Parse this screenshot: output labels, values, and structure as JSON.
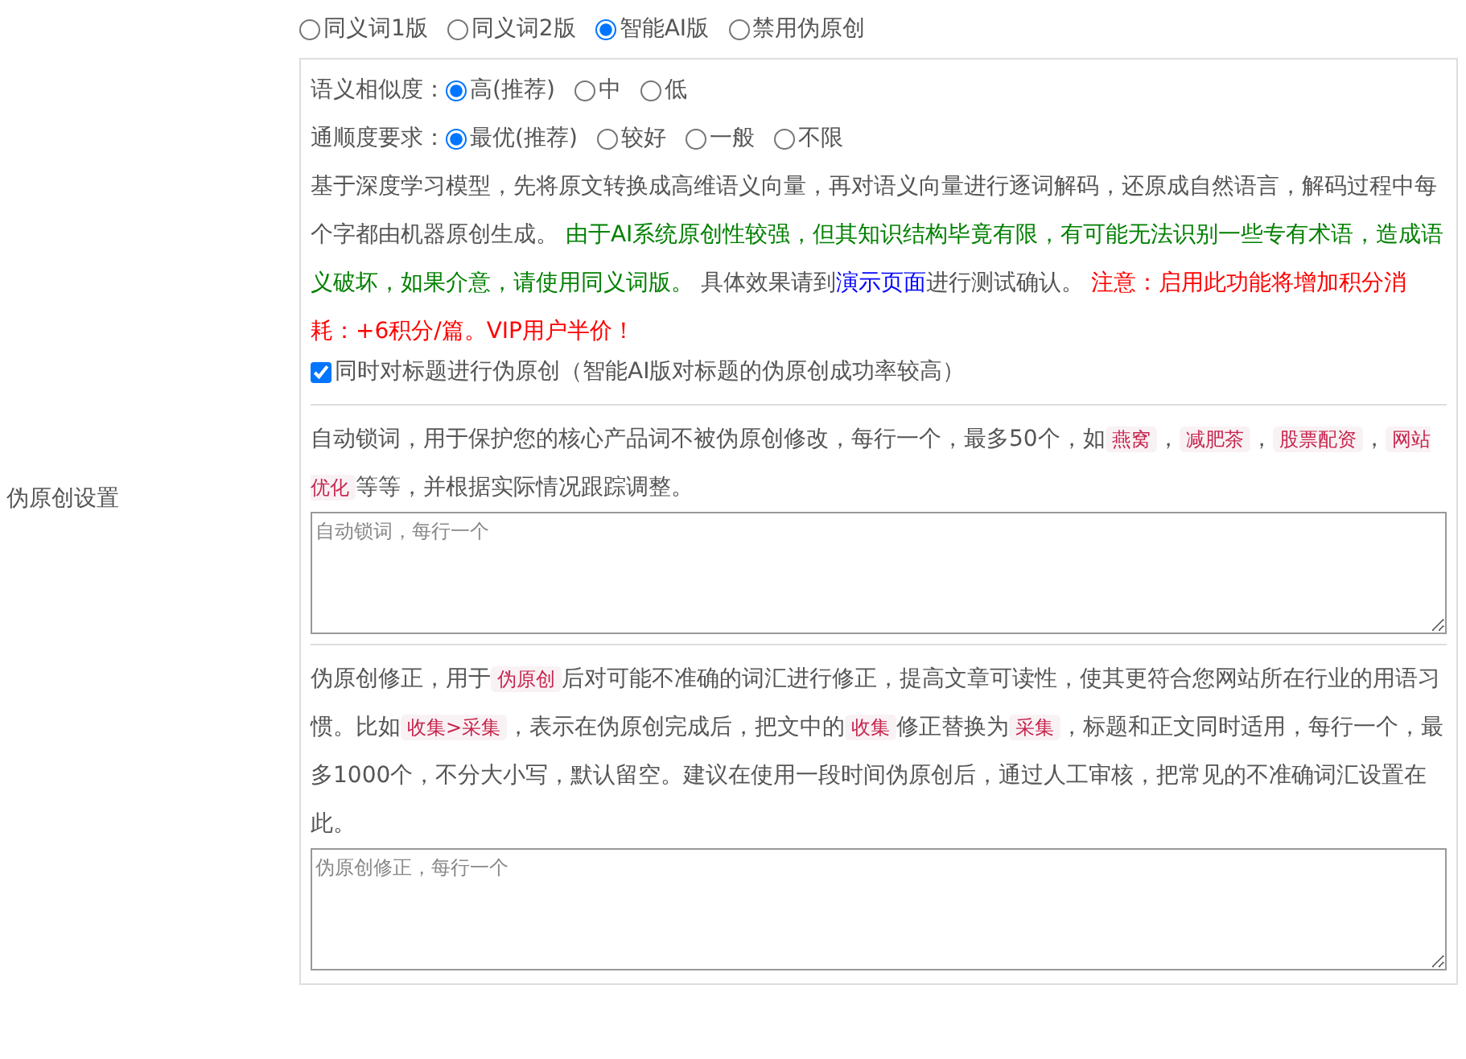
{
  "section_label": "伪原创设置",
  "modes": [
    {
      "label": "同义词1版",
      "selected": false
    },
    {
      "label": "同义词2版",
      "selected": false
    },
    {
      "label": "智能AI版",
      "selected": true
    },
    {
      "label": "禁用伪原创",
      "selected": false
    }
  ],
  "settings": [
    {
      "label": "语义相似度：",
      "options": [
        {
          "label": "高(推荐)",
          "selected": true
        },
        {
          "label": "中",
          "selected": false
        },
        {
          "label": "低",
          "selected": false
        }
      ]
    },
    {
      "label": "通顺度要求：",
      "options": [
        {
          "label": "最优(推荐)",
          "selected": true
        },
        {
          "label": "较好",
          "selected": false
        },
        {
          "label": "一般",
          "selected": false
        },
        {
          "label": "不限",
          "selected": false
        }
      ]
    }
  ],
  "description": [
    {
      "kind": "text",
      "text": "基于深度学习模型，先将原文转换成高维语义向量，再对语义向量进行逐词解码，还原成自然语言，解码过程中每个字都由机器原创生成。 "
    },
    {
      "kind": "notice",
      "text": "由于AI系统原创性较强，但其知识结构毕竟有限，有可能无法识别一些专有术语，造成语义破坏，如果介意，请使用同义词版。"
    },
    {
      "kind": "text",
      "text": " 具体效果请到"
    },
    {
      "kind": "link",
      "text": "演示页面"
    },
    {
      "kind": "text",
      "text": "进行测试确认。 "
    },
    {
      "kind": "warning",
      "text": "注意：启用此功能将增加积分消耗：+6积分/篇。VIP用户半价！"
    }
  ],
  "title_option": {
    "label": "同时对标题进行伪原创（智能AI版对标题的伪原创成功率较高）",
    "checked": true
  },
  "lock_words": {
    "description": [
      {
        "kind": "text",
        "text": "自动锁词，用于保护您的核心产品词不被伪原创修改，每行一个，最多50个，如"
      },
      {
        "kind": "code",
        "text": "燕窝"
      },
      {
        "kind": "text",
        "text": "，"
      },
      {
        "kind": "code",
        "text": "减肥茶"
      },
      {
        "kind": "text",
        "text": "，"
      },
      {
        "kind": "code",
        "text": "股票配资"
      },
      {
        "kind": "text",
        "text": "，"
      },
      {
        "kind": "code",
        "text": "网站优化"
      },
      {
        "kind": "text",
        "text": "等等，并根据实际情况跟踪调整。"
      }
    ],
    "placeholder": "自动锁词，每行一个"
  },
  "correction": {
    "description": [
      {
        "kind": "text",
        "text": "伪原创修正，用于"
      },
      {
        "kind": "code",
        "text": "伪原创"
      },
      {
        "kind": "text",
        "text": "后对可能不准确的词汇进行修正，提高文章可读性，使其更符合您网站所在行业的用语习惯。比如"
      },
      {
        "kind": "code",
        "text": "收集>采集"
      },
      {
        "kind": "text",
        "text": "，表示在伪原创完成后，把文中的"
      },
      {
        "kind": "code",
        "text": "收集"
      },
      {
        "kind": "text",
        "text": "修正替换为"
      },
      {
        "kind": "code",
        "text": "采集"
      },
      {
        "kind": "text",
        "text": "，标题和正文同时适用，每行一个，最多1000个，不分大小写，默认留空。建议在使用一段时间伪原创后，通过人工审核，把常见的不准确词汇设置在此。"
      }
    ],
    "placeholder": "伪原创修正，每行一个"
  }
}
